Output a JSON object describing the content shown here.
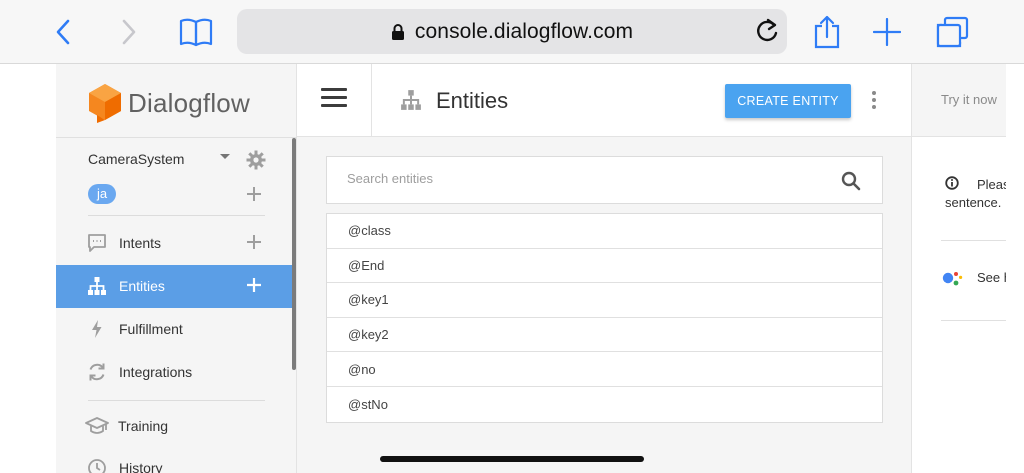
{
  "browser": {
    "url": "console.dialogflow.com"
  },
  "sidebar": {
    "logo_text": "Dialogflow",
    "agent_name": "CameraSystem",
    "language": "ja",
    "items": [
      {
        "label": "Intents"
      },
      {
        "label": "Entities"
      },
      {
        "label": "Fulfillment"
      },
      {
        "label": "Integrations"
      },
      {
        "label": "Training"
      },
      {
        "label": "History"
      }
    ]
  },
  "header": {
    "title": "Entities",
    "create_label": "CREATE ENTITY"
  },
  "search": {
    "placeholder": "Search entities"
  },
  "entities": [
    "@class",
    "@End",
    "@key1",
    "@key2",
    "@no",
    "@stNo"
  ],
  "right_panel": {
    "try_it": "Try it now",
    "info_text": "Pleas sentence.",
    "see_text": "See h"
  },
  "colors": {
    "accent": "#4aa3f0",
    "active_item": "#5b9ee6",
    "logo_orange": "#f5871f"
  }
}
